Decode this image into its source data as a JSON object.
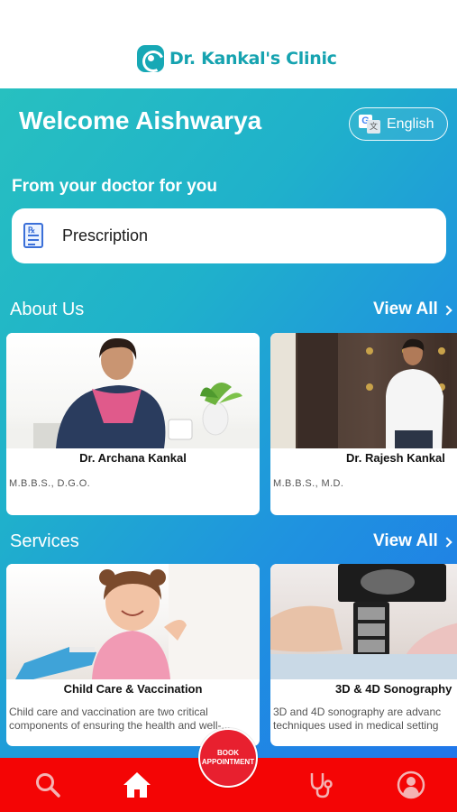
{
  "header": {
    "brand_name": "Dr. Kankal's Clinic",
    "brand_color": "#16a3b0"
  },
  "welcome": {
    "title": "Welcome Aishwarya",
    "language_label": "English"
  },
  "doctor_section": {
    "title": "From your doctor for you",
    "prescription_label": "Prescription"
  },
  "about": {
    "title": "About Us",
    "view_all": "View All",
    "doctors": [
      {
        "name": "Dr. Archana Kankal",
        "qualification": "M.B.B.S., D.G.O."
      },
      {
        "name": "Dr. Rajesh Kankal",
        "qualification": "M.B.B.S., M.D."
      }
    ]
  },
  "services": {
    "title": "Services",
    "view_all": "View All",
    "items": [
      {
        "name": "Child Care & Vaccination",
        "desc_line1": "Child care and vaccination are two critical",
        "desc_line2": "components of ensuring the health and well-..."
      },
      {
        "name": "3D & 4D Sonography",
        "desc_line1": "3D and 4D sonography are advanc",
        "desc_line2": "techniques used in medical setting"
      }
    ]
  },
  "bottom_nav": {
    "book_label_1": "BOOK",
    "book_label_2": "APPOINTMENT",
    "bar_color": "#f40505",
    "items": [
      "search-icon",
      "home-icon",
      "stethoscope-icon",
      "profile-icon"
    ]
  }
}
